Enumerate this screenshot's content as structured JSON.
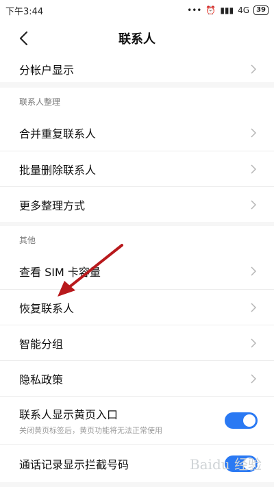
{
  "status": {
    "time": "下午3:44",
    "signal": "4G",
    "battery": "39"
  },
  "header": {
    "title": "联系人"
  },
  "top_item": {
    "label": "分帐户显示"
  },
  "section_organize": {
    "title": "联系人整理",
    "items": [
      {
        "label": "合并重复联系人"
      },
      {
        "label": "批量删除联系人"
      },
      {
        "label": "更多整理方式"
      }
    ]
  },
  "section_other": {
    "title": "其他",
    "items": [
      {
        "label": "查看 SIM 卡容量"
      },
      {
        "label": "恢复联系人"
      },
      {
        "label": "智能分组"
      },
      {
        "label": "隐私政策"
      }
    ],
    "toggles": [
      {
        "label": "联系人显示黄页入口",
        "sub": "关闭黄页标签后，黄页功能将无法正常使用",
        "on": true
      },
      {
        "label": "通话记录显示拦截号码",
        "on": true
      }
    ]
  },
  "colors": {
    "accent": "#2a79f3",
    "arrow": "#b8191c"
  },
  "watermark": "Baidu 经验"
}
